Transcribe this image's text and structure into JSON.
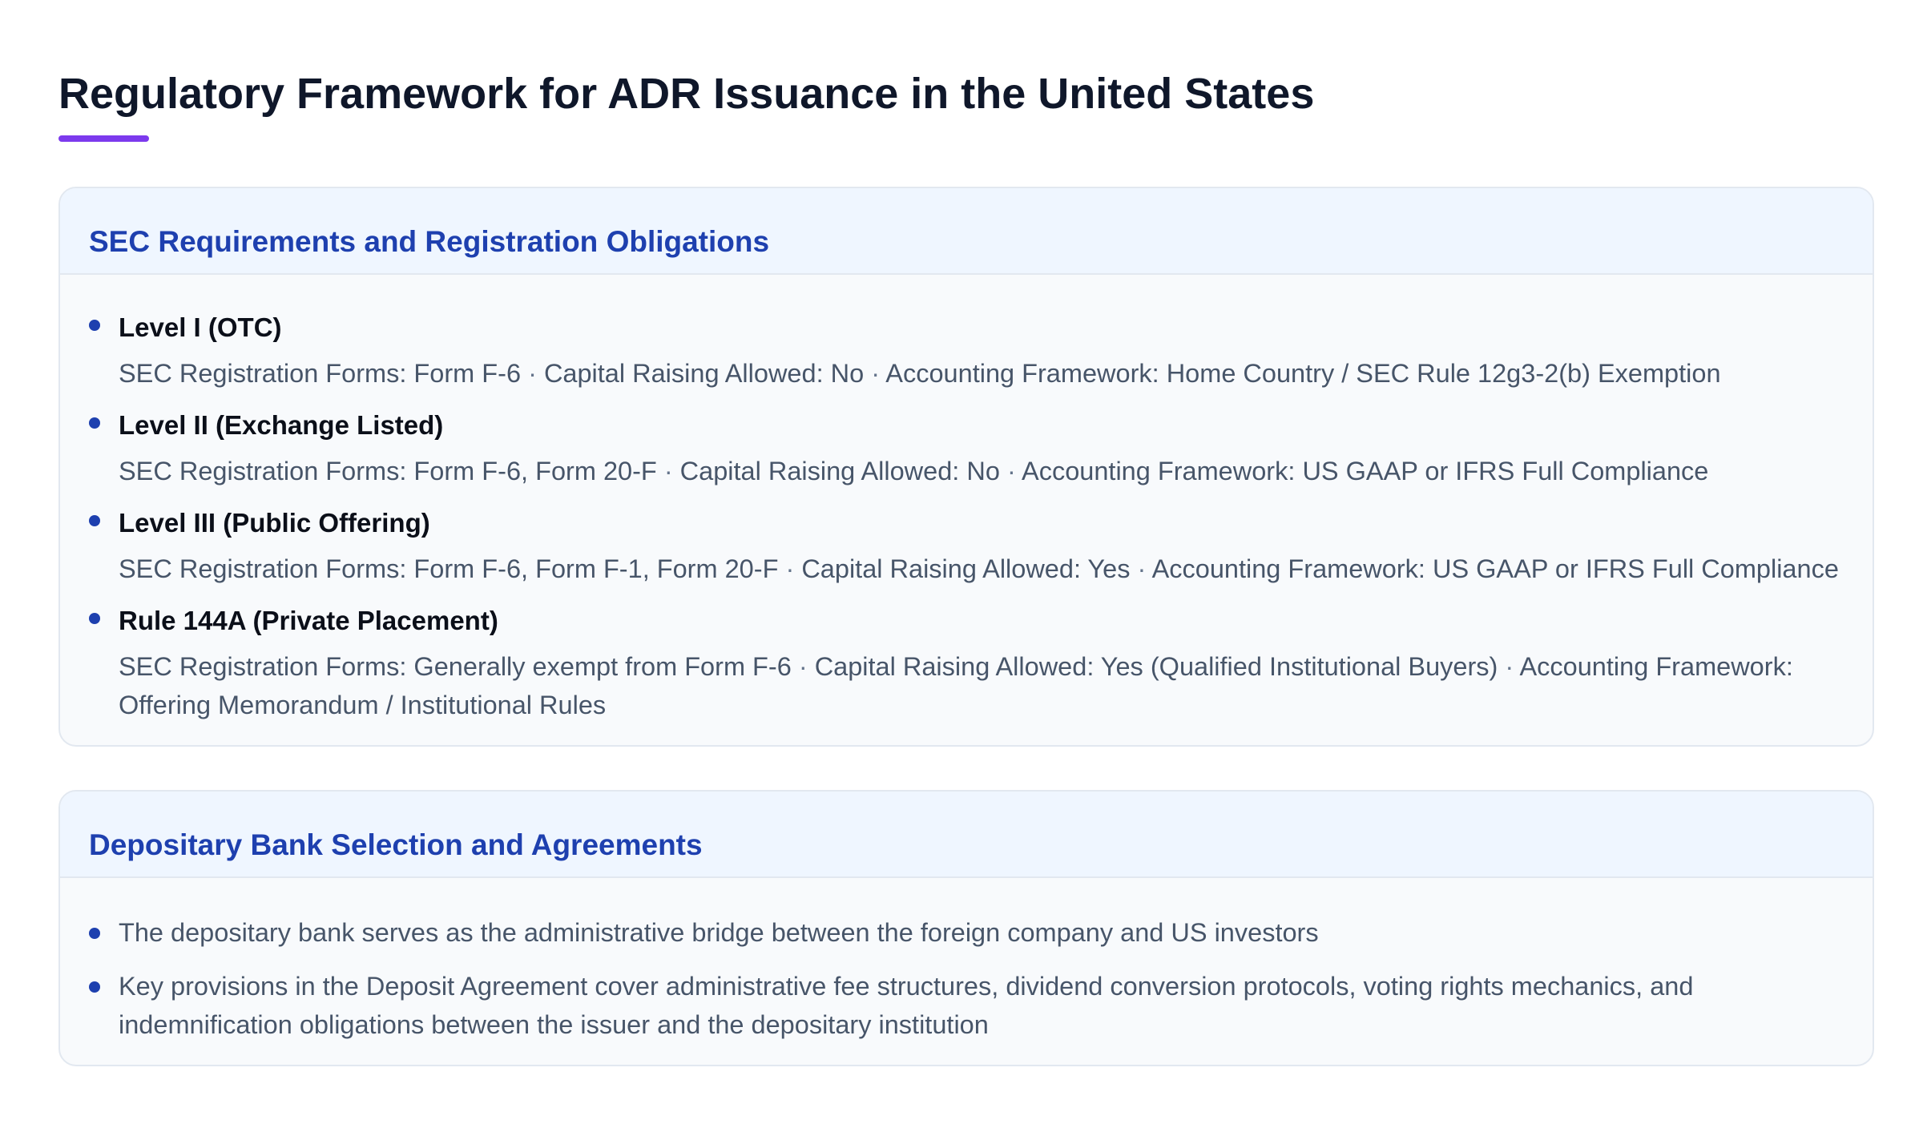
{
  "page": {
    "title": "Regulatory Framework for ADR Issuance in the United States",
    "accent_color": "#7c3aed",
    "heading_color": "#1e40af"
  },
  "sec_section": {
    "heading": "SEC Requirements and Registration Obligations",
    "separator": "·",
    "levels": [
      {
        "title": "Level I (OTC)",
        "forms": "SEC Registration Forms: Form F-6",
        "capital": "Capital Raising Allowed: No",
        "accounting": "Accounting Framework: Home Country / SEC Rule 12g3-2(b) Exemption"
      },
      {
        "title": "Level II (Exchange Listed)",
        "forms": "SEC Registration Forms: Form F-6, Form 20-F",
        "capital": "Capital Raising Allowed: No",
        "accounting": "Accounting Framework: US GAAP or IFRS Full Compliance"
      },
      {
        "title": "Level III (Public Offering)",
        "forms": "SEC Registration Forms: Form F-6, Form F-1, Form 20-F",
        "capital": "Capital Raising Allowed: Yes",
        "accounting": "Accounting Framework: US GAAP or IFRS Full Compliance"
      },
      {
        "title": "Rule 144A (Private Placement)",
        "forms": "SEC Registration Forms: Generally exempt from Form F-6",
        "capital": "Capital Raising Allowed: Yes (Qualified Institutional Buyers)",
        "accounting": "Accounting Framework: Offering Memorandum / Institutional Rules"
      }
    ]
  },
  "depositary_section": {
    "heading": "Depositary Bank Selection and Agreements",
    "items": [
      "The depositary bank serves as the administrative bridge between the foreign company and US investors",
      "Key provisions in the Deposit Agreement cover administrative fee structures, dividend conversion protocols, voting rights mechanics, and indemnification obligations between the issuer and the depositary institution"
    ]
  }
}
